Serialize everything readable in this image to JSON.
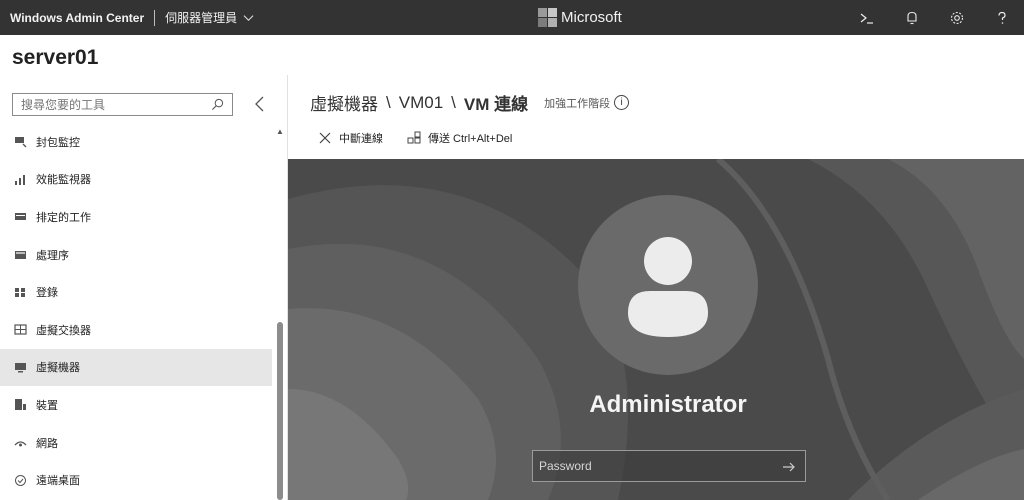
{
  "topbar": {
    "app_title": "Windows Admin Center",
    "context_label": "伺服器管理員",
    "brand": "Microsoft",
    "icons": [
      "terminal-icon",
      "bell-icon",
      "gear-icon",
      "help-icon"
    ]
  },
  "server": {
    "name": "server01"
  },
  "sidebar": {
    "search_placeholder": "搜尋您要的工具",
    "items": [
      {
        "label": "封包監控",
        "icon": "packet-icon"
      },
      {
        "label": "效能監視器",
        "icon": "chart-icon"
      },
      {
        "label": "排定的工作",
        "icon": "task-icon"
      },
      {
        "label": "處理序",
        "icon": "process-icon"
      },
      {
        "label": "登錄",
        "icon": "registry-icon"
      },
      {
        "label": "虛擬交換器",
        "icon": "switch-icon"
      },
      {
        "label": "虛擬機器",
        "icon": "vm-icon",
        "active": true
      },
      {
        "label": "裝置",
        "icon": "device-icon"
      },
      {
        "label": "網路",
        "icon": "network-icon"
      },
      {
        "label": "遠端桌面",
        "icon": "remote-desktop-icon"
      }
    ]
  },
  "breadcrumb": {
    "root": "虛擬機器",
    "sep1": "\\",
    "vm": "VM01",
    "sep2": "\\",
    "current": "VM 連線",
    "hint": "加強工作階段",
    "info": "i"
  },
  "actions": {
    "disconnect": "中斷連線",
    "send_keys": "傳送 Ctrl+Alt+Del"
  },
  "vm": {
    "username": "Administrator",
    "password_placeholder": "Password"
  },
  "colors": {
    "topbar_bg": "#333333",
    "active_item_bg": "#e6e6e6",
    "vm_bg": "#4c4c4c"
  }
}
